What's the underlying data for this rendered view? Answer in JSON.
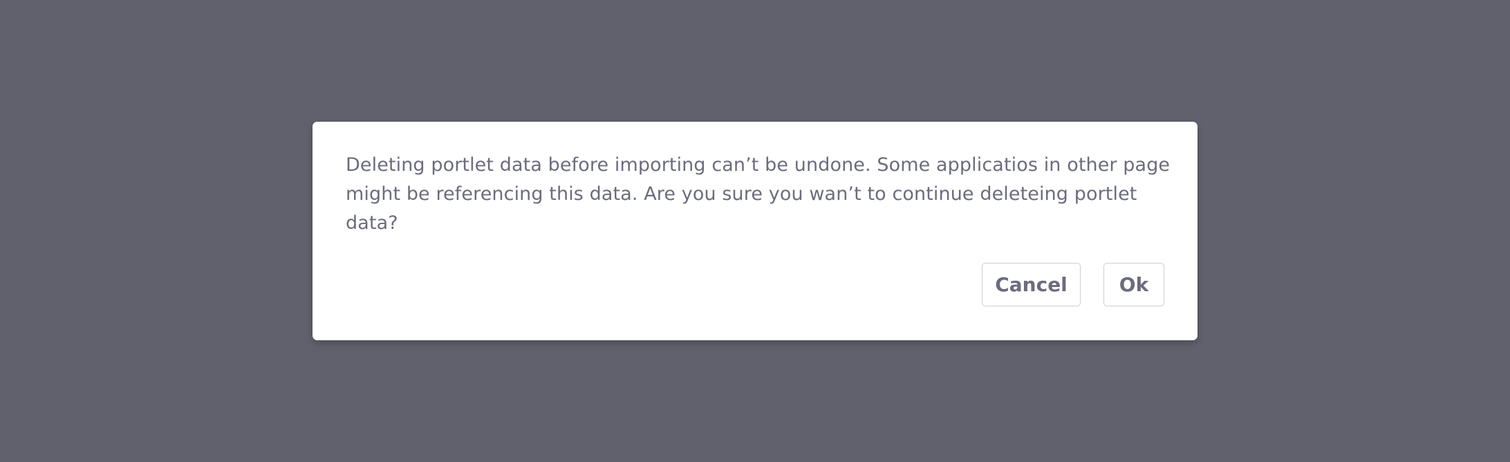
{
  "dialog": {
    "message": "Deleting portlet data before importing can’t be undone. Some applicatios in other page might be referencing this data. Are you sure you wan’t to continue deleteing portlet data?",
    "buttons": {
      "cancel_label": "Cancel",
      "ok_label": "Ok"
    }
  },
  "colors": {
    "backdrop": "#61616e",
    "dialog_background": "#ffffff",
    "text": "#6b6c7e",
    "button_border": "#cdced9"
  }
}
